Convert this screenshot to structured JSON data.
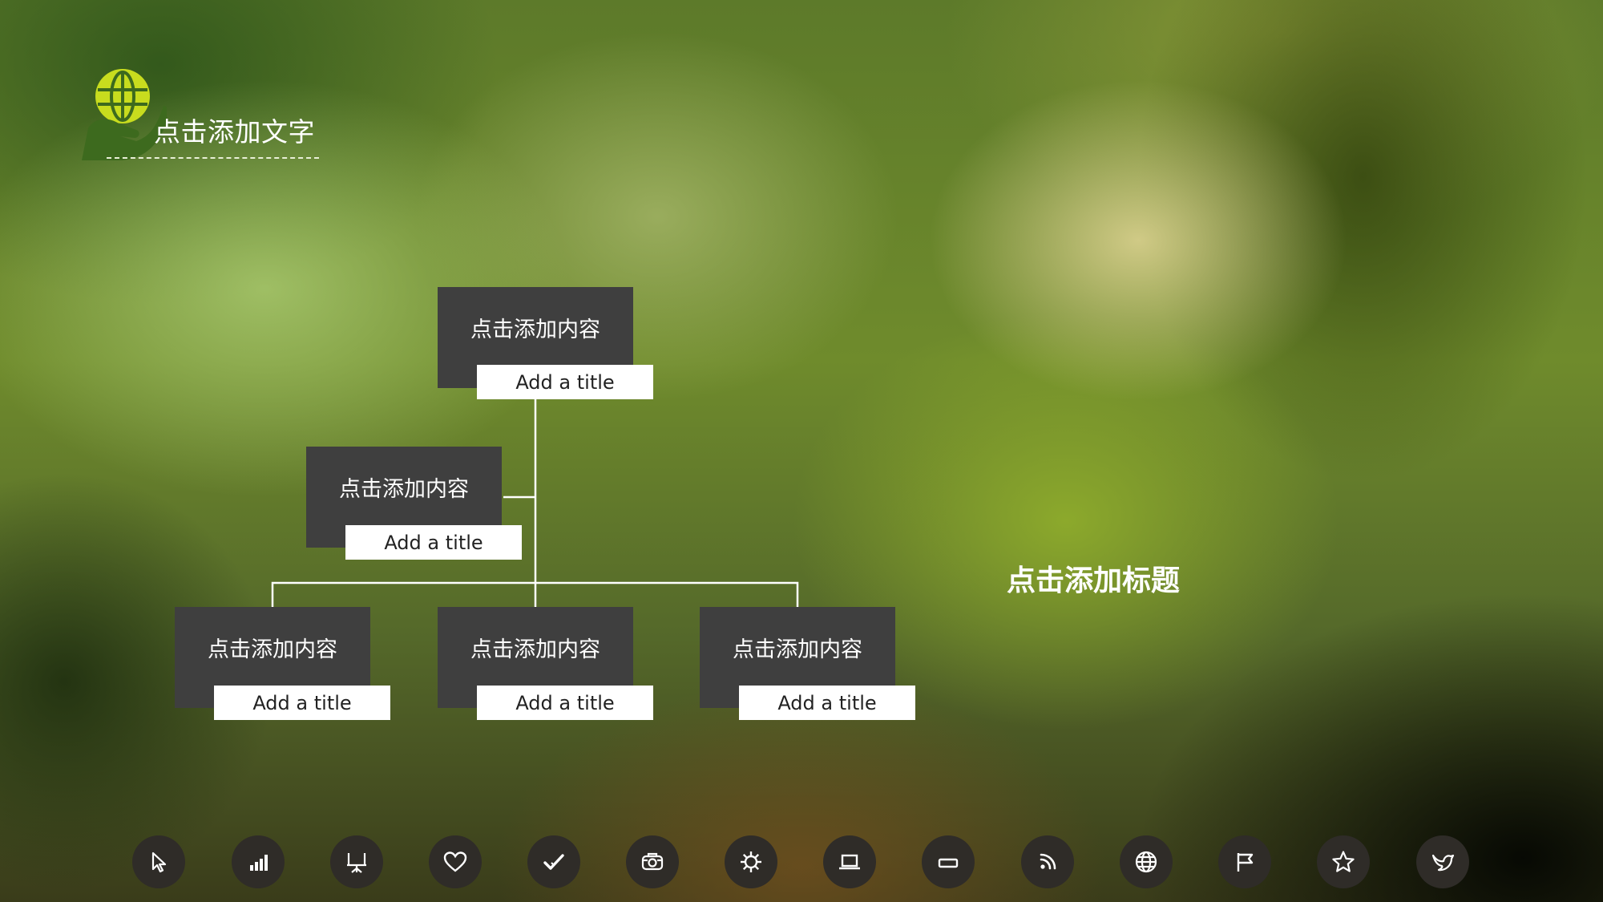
{
  "header": {
    "title": "点击添加文字",
    "logo_icon": "globe-in-hand-icon"
  },
  "org_chart": {
    "nodes": [
      {
        "id": "root",
        "content": "点击添加内容",
        "title": "Add a title"
      },
      {
        "id": "middle",
        "content": "点击添加内容",
        "title": "Add a title"
      },
      {
        "id": "leaf-1",
        "content": "点击添加内容",
        "title": "Add a title"
      },
      {
        "id": "leaf-2",
        "content": "点击添加内容",
        "title": "Add a title"
      },
      {
        "id": "leaf-3",
        "content": "点击添加内容",
        "title": "Add a title"
      }
    ]
  },
  "side_title": "点击添加标题",
  "colors": {
    "box": "#3f3f3f",
    "tag": "#ffffff",
    "connector": "#ffffff",
    "logo_globe": "#c8dc1e",
    "logo_hand": "#3d6a1e",
    "icon_bg": "#2f2c28"
  },
  "icon_bar": [
    "cursor-icon",
    "bar-chart-icon",
    "presentation-icon",
    "heart-icon",
    "checkmark-icon",
    "camera-icon",
    "gear-icon",
    "laptop-icon",
    "battery-icon",
    "rss-icon",
    "globe-icon",
    "flag-icon",
    "star-icon",
    "bird-icon"
  ]
}
